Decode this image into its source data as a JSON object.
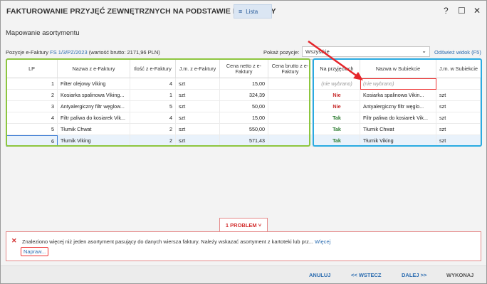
{
  "window": {
    "title": "FAKTUROWANIE PRZYJĘĆ ZEWNĘTRZNYCH NA PODSTAWIE E-FAKTURY",
    "lista_label": "Lista",
    "help": "?",
    "maximize": "☐",
    "close": "✕"
  },
  "section_title": "Mapowanie asortymentu",
  "toolbar": {
    "positions_prefix": "Pozycje e-Faktury ",
    "doc_link": "FS 1/3/PZ/2023",
    "positions_suffix": " (wartość brutto: 2171,96 PLN)",
    "show_label": "Pokaż pozycje:",
    "show_value": "Wszystkie",
    "refresh": "Odśwież widok (F5)"
  },
  "columns": {
    "lp": "LP",
    "name_ef": "Nazwa z e-Faktury",
    "qty": "Ilość z e-Faktury",
    "unit_ef": "J.m. z e-Faktury",
    "net": "Cena netto z e-Faktury",
    "gross": "Cena brutto z e-Faktury",
    "accept": "Na przyjęciach",
    "name_sub": "Nazwa w Subiekcie",
    "unit_sub": "J.m. w Subiekcie"
  },
  "rows": [
    {
      "lp": "1",
      "name": "Filter olejowy Viking",
      "qty": "4",
      "unit": "szt",
      "net": "15,00",
      "gross": "",
      "accept": "(nie wybrano)",
      "sub_name": "(nie wybrano)",
      "sub_unit": ""
    },
    {
      "lp": "2",
      "name": "Kosiarka spalinowa Viking...",
      "qty": "1",
      "unit": "szt",
      "net": "324,39",
      "gross": "",
      "accept": "Nie",
      "sub_name": "Kosiarka spalinowa Vikin...",
      "sub_unit": "szt"
    },
    {
      "lp": "3",
      "name": "Antyalergiczny filtr węglow...",
      "qty": "5",
      "unit": "szt",
      "net": "50,00",
      "gross": "",
      "accept": "Nie",
      "sub_name": "Antyalergiczny filtr węglo...",
      "sub_unit": "szt"
    },
    {
      "lp": "4",
      "name": "Filtr paliwa do kosiarek Vik...",
      "qty": "4",
      "unit": "szt",
      "net": "15,00",
      "gross": "",
      "accept": "Tak",
      "sub_name": "Filtr paliwa do kosiarek Vik...",
      "sub_unit": "szt"
    },
    {
      "lp": "5",
      "name": "Tłumik Chwat",
      "qty": "2",
      "unit": "szt",
      "net": "550,00",
      "gross": "",
      "accept": "Tak",
      "sub_name": "Tłumik Chwat",
      "sub_unit": "szt"
    },
    {
      "lp": "6",
      "name": "Tłumik Viking",
      "qty": "2",
      "unit": "szt",
      "net": "571,43",
      "gross": "",
      "accept": "Tak",
      "sub_name": "Tłumik Viking",
      "sub_unit": "szt"
    }
  ],
  "problem": {
    "tab_label": "1 PROBLEM ˅",
    "message": "Znaleziono więcej niż jeden asortyment pasujący do danych wiersza faktury. Należy wskazać asortyment z kartoteki lub prz... ",
    "more_link": "Więcej",
    "fix_link": "Napraw..."
  },
  "footer": {
    "cancel": "ANULUJ",
    "back": "<< WSTECZ",
    "next": "DALEJ >>",
    "finish": "WYKONAJ"
  },
  "colors": {
    "accent": "#2b6cb0",
    "error": "#d32f2f",
    "yes": "#2e7d32",
    "green_box": "#8dc63f",
    "blue_box": "#29abe2"
  }
}
